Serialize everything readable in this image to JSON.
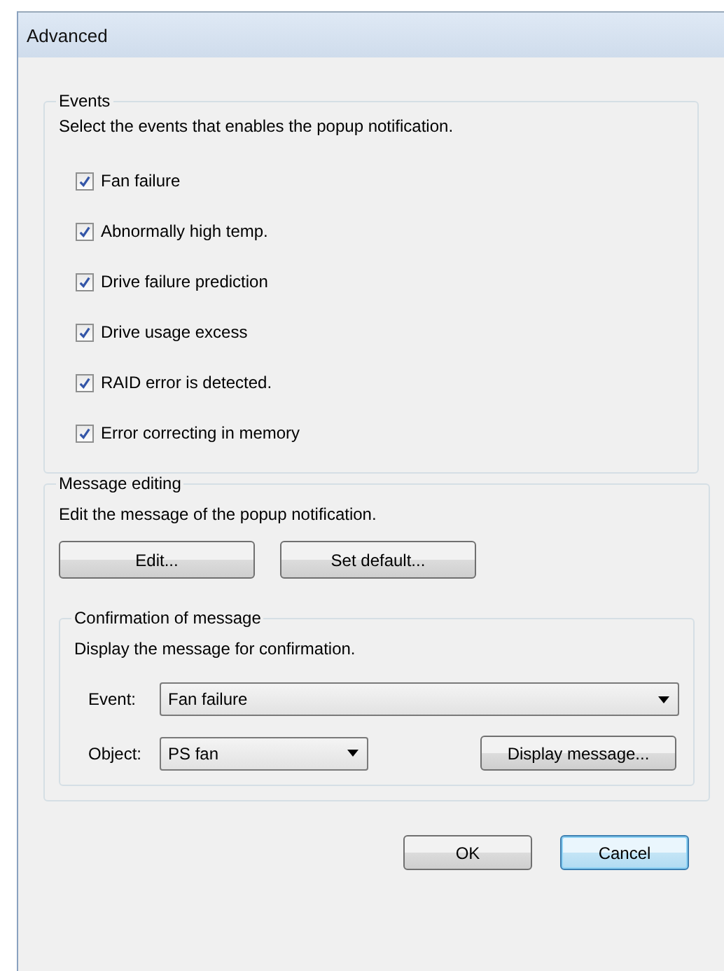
{
  "window": {
    "title": "Advanced"
  },
  "events": {
    "title": "Events",
    "description": "Select the events that enables the popup notification.",
    "items": [
      {
        "label": "Fan failure",
        "checked": true
      },
      {
        "label": "Abnormally high temp.",
        "checked": true
      },
      {
        "label": "Drive failure prediction",
        "checked": true
      },
      {
        "label": "Drive usage excess",
        "checked": true
      },
      {
        "label": "RAID error is detected.",
        "checked": true
      },
      {
        "label": "Error correcting in memory",
        "checked": true
      }
    ]
  },
  "message_editing": {
    "title": "Message editing",
    "description": "Edit the message of the popup notification.",
    "buttons": [
      "Edit...",
      "Set default..."
    ],
    "confirmation": {
      "title": "Confirmation of message",
      "description": "Display the message for confirmation.",
      "event_label": "Event:",
      "event_value": "Fan failure",
      "object_label": "Object:",
      "object_value": "PS fan",
      "display_button": "Display message..."
    }
  },
  "buttons": [
    {
      "label": "OK",
      "focused": false
    },
    {
      "label": "Cancel",
      "focused": true
    }
  ]
}
